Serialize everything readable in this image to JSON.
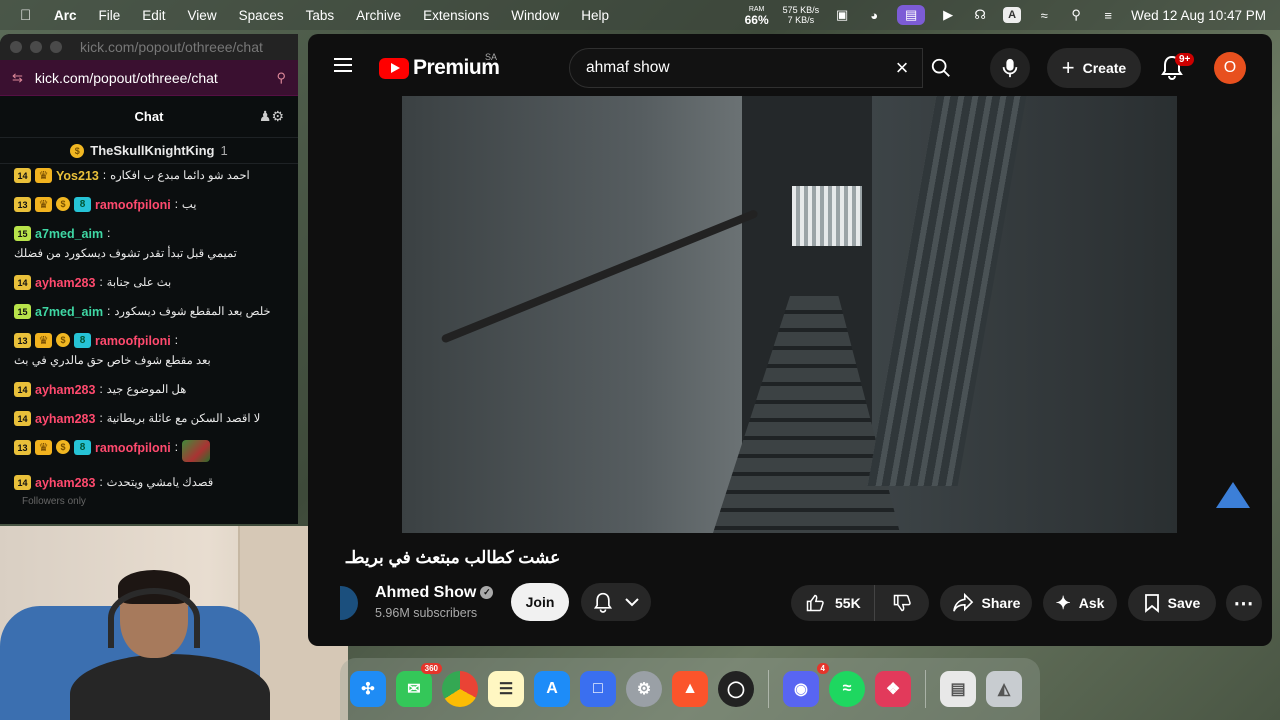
{
  "menubar": {
    "app_name": "Arc",
    "items": [
      "File",
      "Edit",
      "View",
      "Spaces",
      "Tabs",
      "Archive",
      "Extensions",
      "Window",
      "Help"
    ],
    "ram_label": "RAM",
    "ram_value": "66%",
    "net_up": "575 KB/s",
    "net_down": "7 KB/s",
    "input_badge": "A",
    "clock": "Wed 12 Aug  10:47 PM"
  },
  "kick": {
    "window_title": "kick.com/popout/othreee/chat",
    "url": "kick.com/popout/othreee/chat",
    "chat_header": "Chat",
    "pinned_user": "TheSkullKnightKing",
    "pinned_count": "1",
    "messages": [
      {
        "badge": "14",
        "user": "Yos213",
        "color": "#e9c03a",
        "text": "احمد شو دائما مبدع ب افكاره"
      },
      {
        "badge": "13",
        "user": "ramoofpiloni",
        "color": "#ff4a6e",
        "text": "يب"
      },
      {
        "badge": "15",
        "user": "a7med_aim",
        "color": "#3fd7a4",
        "text": "تميمي قبل تبدأ تقدر تشوف ديسكورد من فضلك"
      },
      {
        "badge": "14",
        "user": "ayham283",
        "color": "#ff4a6e",
        "text": "بث على جنابة"
      },
      {
        "badge": "15",
        "user": "a7med_aim",
        "color": "#3fd7a4",
        "text": "خلص بعد المقطع شوف ديسكورد"
      },
      {
        "badge": "13",
        "user": "ramoofpiloni",
        "color": "#ff4a6e",
        "text": "بعد مقطع شوف خاص حق مالدري في بث"
      },
      {
        "badge": "14",
        "user": "ayham283",
        "color": "#ff4a6e",
        "text": "هل الموضوع جيد"
      },
      {
        "badge": "14",
        "user": "ayham283",
        "color": "#ff4a6e",
        "text": "لا اقصد السكن مع عائلة بريطانية"
      },
      {
        "badge": "13",
        "user": "ramoofpiloni",
        "color": "#ff4a6e",
        "text": ""
      },
      {
        "badge": "14",
        "user": "ayham283",
        "color": "#ff4a6e",
        "text": "قصدك يامشي ويتحدث"
      }
    ],
    "footer": "Followers only"
  },
  "youtube": {
    "brand": "Premium",
    "country": "SA",
    "search_value": "ahmaf show",
    "create_label": "Create",
    "notif_badge": "9+",
    "avatar_letter": "O",
    "video_title": "عشت كطالب مبتعث في بريطـ",
    "channel_name": "Ahmed Show",
    "subscribers": "5.96M subscribers",
    "join_label": "Join",
    "likes": "55K",
    "share_label": "Share",
    "ask_label": "Ask",
    "save_label": "Save"
  },
  "dock": {
    "messages_badge": "360",
    "discord_badge": "4"
  }
}
